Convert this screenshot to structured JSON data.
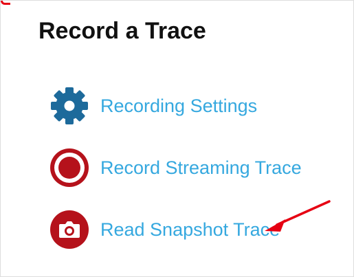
{
  "panel": {
    "title": "Record a Trace"
  },
  "menu": {
    "items": [
      {
        "label": "Recording Settings",
        "icon": "gear-icon",
        "icon_color": "#1d6a9b"
      },
      {
        "label": "Record Streaming Trace",
        "icon": "record-icon",
        "icon_color": "#b5121b"
      },
      {
        "label": "Read Snapshot Trace",
        "icon": "camera-icon",
        "icon_color": "#b5121b"
      }
    ]
  },
  "annotation": {
    "arrow_color": "#e60012"
  },
  "colors": {
    "link_text": "#35a8df",
    "title_text": "#111111"
  }
}
